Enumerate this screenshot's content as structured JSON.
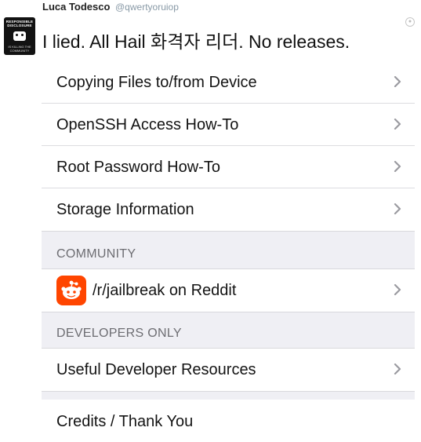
{
  "tweet": {
    "name": "Luca Todesco",
    "handle": "@qwertyoruiop",
    "text": "I lied. All Hail 화격자 리더. No releases.",
    "avatar_text_top": "RESPONSIBLE DISCLOSURE",
    "avatar_text_bottom": "IS KILLING THE COMMUNITY"
  },
  "menu": {
    "rows": [
      {
        "label": "Copying Files to/from Device",
        "icon": "chevron-right-icon"
      },
      {
        "label": "OpenSSH Access How-To",
        "icon": "chevron-right-icon"
      },
      {
        "label": "Root Password How-To",
        "icon": "chevron-right-icon"
      },
      {
        "label": "Storage Information",
        "icon": "chevron-right-icon"
      }
    ],
    "community": {
      "header": "COMMUNITY",
      "items": [
        {
          "label": "/r/jailbreak on Reddit",
          "icon": "reddit-icon"
        }
      ]
    },
    "developers": {
      "header": "DEVELOPERS ONLY",
      "items": [
        {
          "label": "Useful Developer Resources",
          "icon": "chevron-right-icon"
        }
      ]
    },
    "credits": {
      "label": "Credits / Thank You"
    }
  },
  "colors": {
    "group_background": "#efeff4",
    "reddit_orange": "#ff4500",
    "chevron": "#c7c7cc",
    "section_header_text": "#6d6d72"
  }
}
